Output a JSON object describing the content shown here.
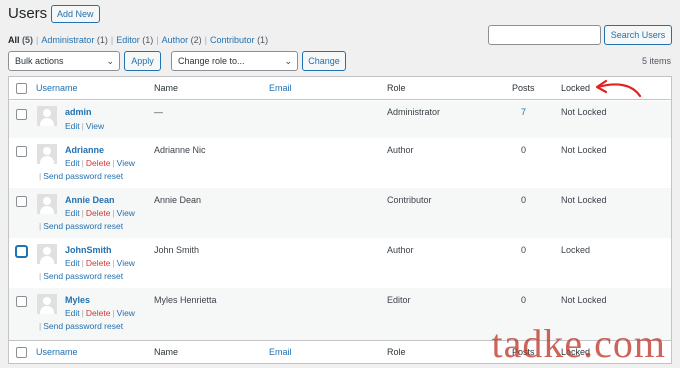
{
  "header": {
    "title": "Users",
    "add_new": "Add New"
  },
  "filters": [
    {
      "label": "All",
      "count": "(5)",
      "current": true
    },
    {
      "label": "Administrator",
      "count": "(1)"
    },
    {
      "label": "Editor",
      "count": "(1)"
    },
    {
      "label": "Author",
      "count": "(2)"
    },
    {
      "label": "Contributor",
      "count": "(1)"
    }
  ],
  "search": {
    "button": "Search Users",
    "value": ""
  },
  "bulk": {
    "selected": "Bulk actions",
    "apply": "Apply"
  },
  "role_change": {
    "selected": "Change role to...",
    "change": "Change"
  },
  "items_count": "5 items",
  "columns": {
    "username": "Username",
    "name": "Name",
    "email": "Email",
    "role": "Role",
    "posts": "Posts",
    "locked": "Locked"
  },
  "users": [
    {
      "username": "admin",
      "name": "—",
      "role": "Administrator",
      "posts": "7",
      "locked": "Not Locked",
      "actions": {
        "edit": "Edit",
        "view": "View"
      }
    },
    {
      "username": "Adrianne",
      "name": "Adrianne Nic",
      "role": "Author",
      "posts": "0",
      "locked": "Not Locked",
      "actions": {
        "edit": "Edit",
        "delete": "Delete",
        "view": "View",
        "reset": "Send password reset"
      }
    },
    {
      "username": "Annie Dean",
      "name": "Annie Dean",
      "role": "Contributor",
      "posts": "0",
      "locked": "Not Locked",
      "actions": {
        "edit": "Edit",
        "delete": "Delete",
        "view": "View",
        "reset": "Send password reset"
      }
    },
    {
      "username": "JohnSmith",
      "name": "John Smith",
      "role": "Author",
      "posts": "0",
      "locked": "Locked",
      "actions": {
        "edit": "Edit",
        "delete": "Delete",
        "view": "View",
        "reset": "Send password reset"
      }
    },
    {
      "username": "Myles",
      "name": "Myles Henrietta",
      "role": "Editor",
      "posts": "0",
      "locked": "Not Locked",
      "actions": {
        "edit": "Edit",
        "delete": "Delete",
        "view": "View",
        "reset": "Send password reset"
      }
    }
  ],
  "annotation": {
    "icon": "red-arrow-icon",
    "color": "#e02424"
  },
  "watermark": "tadke.com",
  "colors": {
    "link": "#2271b1",
    "delete": "#d63638",
    "background": "#f0f0f1"
  }
}
